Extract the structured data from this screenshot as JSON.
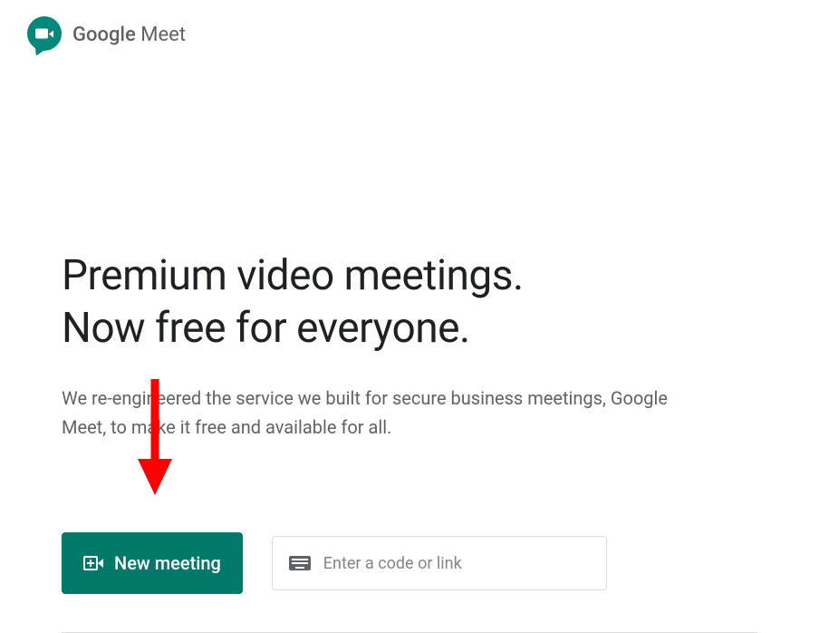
{
  "header": {
    "brand_google": "Google",
    "brand_product": " Meet"
  },
  "main": {
    "headline_line1": "Premium video meetings.",
    "headline_line2": "Now free for everyone.",
    "subtext": "We re-engineered the service we built for secure business meetings, Google Meet, to make it free and available for all."
  },
  "actions": {
    "new_meeting_label": "New meeting",
    "code_input_placeholder": "Enter a code or link"
  },
  "colors": {
    "brand_teal": "#00796b",
    "text_primary": "#202124",
    "text_secondary": "#5f6368"
  }
}
